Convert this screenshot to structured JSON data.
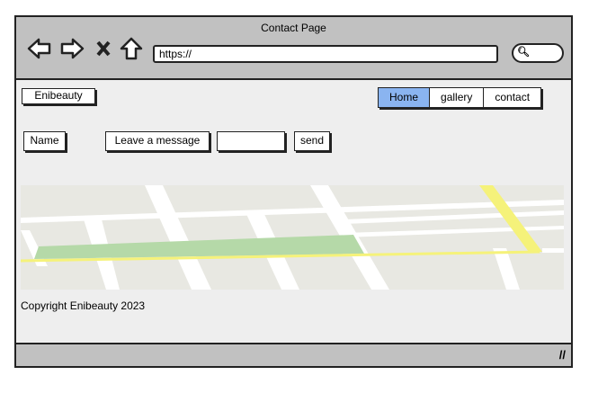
{
  "window": {
    "title": "Contact Page",
    "url": "https://"
  },
  "header": {
    "logo": "Enibeauty",
    "nav": [
      {
        "label": "Home",
        "active": true
      },
      {
        "label": "gallery"
      },
      {
        "label": "contact"
      }
    ]
  },
  "form": {
    "name_label": "Name",
    "message_label": "Leave a message",
    "message_value": "",
    "send_label": "send"
  },
  "footer": {
    "copyright": "Copyright Enibeauty 2023"
  },
  "colors": {
    "active_tab": "#8ab4f0",
    "chrome": "#c1c1c1",
    "map_road_major": "#f5f27a",
    "map_park": "#b5d9a8"
  }
}
